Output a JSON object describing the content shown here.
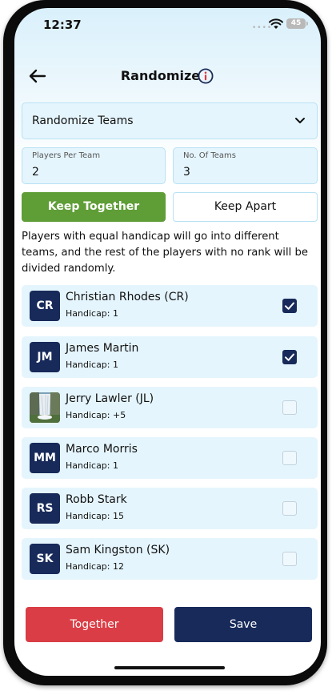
{
  "status_bar": {
    "time": "12:37",
    "battery": "45"
  },
  "header": {
    "title": "Randomize"
  },
  "mode_select": {
    "value": "Randomize Teams"
  },
  "players_per_team": {
    "label": "Players Per Team",
    "value": "2"
  },
  "no_of_teams": {
    "label": "No. Of Teams",
    "value": "3"
  },
  "toggle": {
    "keep_together": "Keep Together",
    "keep_apart": "Keep Apart",
    "selected": "Keep Together"
  },
  "description": "Players with equal handicap will go into different teams, and the rest of the players with no rank will be divided randomly.",
  "players": [
    {
      "initials": "CR",
      "name": "Christian Rhodes (CR)",
      "handicap": "Handicap: 1",
      "checked": true
    },
    {
      "initials": "JM",
      "name": "James Martin",
      "handicap": "Handicap: 1",
      "checked": true
    },
    {
      "initials": "",
      "avatar": "waterfall-photo",
      "name": "Jerry Lawler (JL)",
      "handicap": "Handicap: +5",
      "checked": false
    },
    {
      "initials": "MM",
      "name": "Marco Morris",
      "handicap": "Handicap: 1",
      "checked": false
    },
    {
      "initials": "RS",
      "name": "Robb Stark",
      "handicap": "Handicap: 15",
      "checked": false
    },
    {
      "initials": "SK",
      "name": "Sam Kingston (SK)",
      "handicap": "Handicap: 12",
      "checked": false
    }
  ],
  "buttons": {
    "together": "Together",
    "save": "Save"
  },
  "colors": {
    "navy": "#182a5a",
    "green": "#5f9d37",
    "red": "#da3d45",
    "field_bg": "#e5f5fd",
    "field_border": "#b7e1f3"
  }
}
